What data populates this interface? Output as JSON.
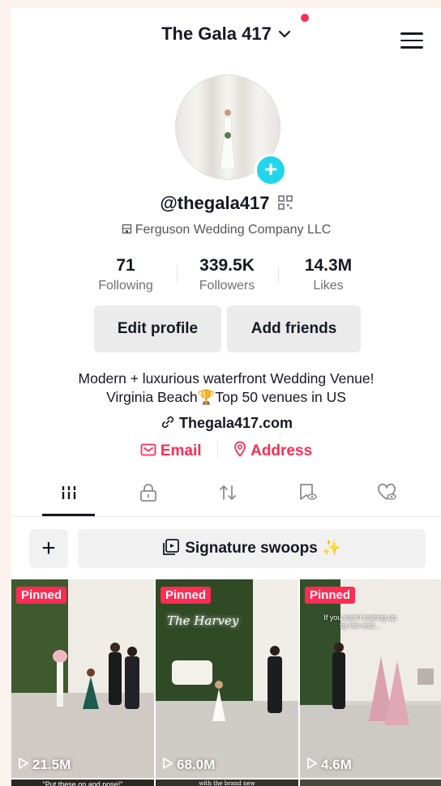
{
  "header": {
    "title": "The Gala 417",
    "title_chevron": "chevron-down-icon",
    "menu_icon": "hamburger-menu-icon"
  },
  "profile": {
    "username": "@thegala417",
    "company": "Ferguson Wedding Company LLC",
    "stats": [
      {
        "value": "71",
        "label": "Following"
      },
      {
        "value": "339.5K",
        "label": "Followers"
      },
      {
        "value": "14.3M",
        "label": "Likes"
      }
    ],
    "buttons": {
      "edit": "Edit profile",
      "add_friends": "Add friends"
    },
    "bio_line1": "Modern + luxurious waterfront Wedding Venue!",
    "bio_line2_a": "Virginia Beach",
    "bio_line2_emoji": "🏆",
    "bio_line2_b": "Top 50 venues in US",
    "link": "Thegala417.com",
    "email_label": "Email",
    "address_label": "Address"
  },
  "tabs": [
    "videos-grid-icon",
    "private-lock-icon",
    "reposts-icon",
    "saved-icon",
    "liked-icon"
  ],
  "playlist": {
    "label": "Signature swoops",
    "emoji": "✨"
  },
  "videos": [
    {
      "badge": "Pinned",
      "views": "21.5M"
    },
    {
      "badge": "Pinned",
      "views": "68.0M",
      "neon": "The Harvey"
    },
    {
      "badge": "Pinned",
      "views": "4.6M",
      "caption": "If you aren't tearing up by the end..."
    }
  ],
  "bottom_row": {
    "caption1": "\"Put these on and pose!\"",
    "caption2": "with the brand new"
  },
  "colors": {
    "accent": "#fe2c55",
    "avatar_add": "#20d5ec",
    "button_bg": "#ebebeb"
  }
}
